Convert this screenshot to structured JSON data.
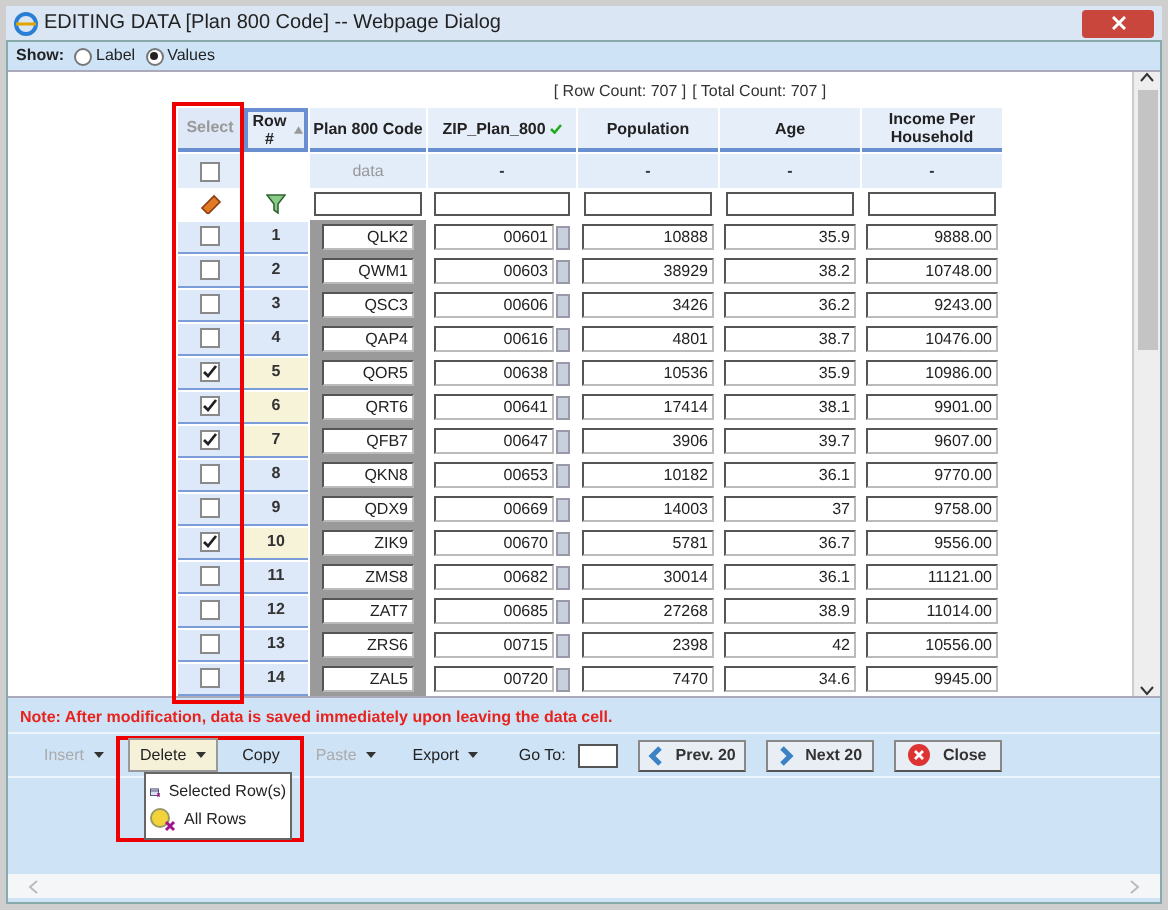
{
  "window": {
    "title": "EDITING DATA [Plan 800 Code] -- Webpage Dialog"
  },
  "show": {
    "label": "Show:",
    "options": [
      {
        "label": "Label",
        "selected": false
      },
      {
        "label": "Values",
        "selected": true
      }
    ]
  },
  "counts": [
    "[ Row Count: 707 ]",
    "[ Total Count: 707 ]"
  ],
  "table": {
    "select_header": "Select",
    "columns": [
      "Row #",
      "Plan 800 Code",
      "ZIP_Plan_800",
      "Population",
      "Age",
      "Income Per Household"
    ],
    "summary": {
      "checked": false,
      "cells": [
        "data",
        "-",
        "-",
        "-",
        "-"
      ]
    },
    "rows": [
      {
        "checked": false,
        "row": "1",
        "code": "QLK2",
        "zip": "00601",
        "population": "10888",
        "age": "35.9",
        "income": "9888.00"
      },
      {
        "checked": false,
        "row": "2",
        "code": "QWM1",
        "zip": "00603",
        "population": "38929",
        "age": "38.2",
        "income": "10748.00"
      },
      {
        "checked": false,
        "row": "3",
        "code": "QSC3",
        "zip": "00606",
        "population": "3426",
        "age": "36.2",
        "income": "9243.00"
      },
      {
        "checked": false,
        "row": "4",
        "code": "QAP4",
        "zip": "00616",
        "population": "4801",
        "age": "38.7",
        "income": "10476.00"
      },
      {
        "checked": true,
        "row": "5",
        "code": "QOR5",
        "zip": "00638",
        "population": "10536",
        "age": "35.9",
        "income": "10986.00"
      },
      {
        "checked": true,
        "row": "6",
        "code": "QRT6",
        "zip": "00641",
        "population": "17414",
        "age": "38.1",
        "income": "9901.00"
      },
      {
        "checked": true,
        "row": "7",
        "code": "QFB7",
        "zip": "00647",
        "population": "3906",
        "age": "39.7",
        "income": "9607.00"
      },
      {
        "checked": false,
        "row": "8",
        "code": "QKN8",
        "zip": "00653",
        "population": "10182",
        "age": "36.1",
        "income": "9770.00"
      },
      {
        "checked": false,
        "row": "9",
        "code": "QDX9",
        "zip": "00669",
        "population": "14003",
        "age": "37",
        "income": "9758.00"
      },
      {
        "checked": true,
        "row": "10",
        "code": "ZIK9",
        "zip": "00670",
        "population": "5781",
        "age": "36.7",
        "income": "9556.00"
      },
      {
        "checked": false,
        "row": "11",
        "code": "ZMS8",
        "zip": "00682",
        "population": "30014",
        "age": "36.1",
        "income": "11121.00"
      },
      {
        "checked": false,
        "row": "12",
        "code": "ZAT7",
        "zip": "00685",
        "population": "27268",
        "age": "38.9",
        "income": "11014.00"
      },
      {
        "checked": false,
        "row": "13",
        "code": "ZRS6",
        "zip": "00715",
        "population": "2398",
        "age": "42",
        "income": "10556.00"
      },
      {
        "checked": false,
        "row": "14",
        "code": "ZAL5",
        "zip": "00720",
        "population": "7470",
        "age": "34.6",
        "income": "9945.00"
      }
    ]
  },
  "note": "Note: After modification, data is saved immediately upon leaving the data cell.",
  "toolbar": {
    "items": [
      {
        "label": "Insert",
        "disabled": true,
        "dropdown": true,
        "open": false
      },
      {
        "label": "Delete",
        "disabled": false,
        "dropdown": true,
        "open": true
      },
      {
        "label": "Copy",
        "disabled": false,
        "dropdown": false,
        "open": false
      },
      {
        "label": "Paste",
        "disabled": true,
        "dropdown": true,
        "open": false
      },
      {
        "label": "Export",
        "disabled": false,
        "dropdown": true,
        "open": false
      }
    ],
    "goto_label": "Go To:",
    "buttons": [
      {
        "kind": "prev",
        "label": "Prev. 20"
      },
      {
        "kind": "next",
        "label": "Next 20"
      },
      {
        "kind": "close",
        "label": "Close"
      }
    ]
  },
  "delete_menu": [
    {
      "kind": "selected",
      "label": "Selected Row(s)"
    },
    {
      "kind": "all",
      "label": "All Rows"
    }
  ]
}
